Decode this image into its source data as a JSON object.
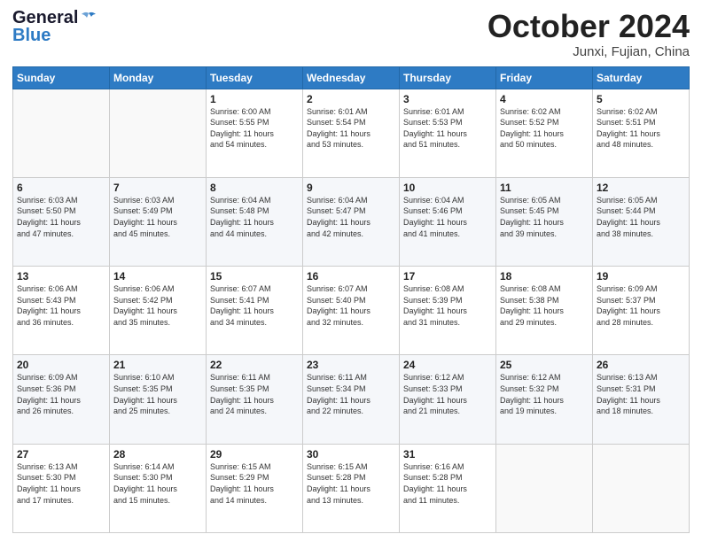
{
  "header": {
    "logo_general": "General",
    "logo_blue": "Blue",
    "month_title": "October 2024",
    "location": "Junxi, Fujian, China"
  },
  "calendar": {
    "days_of_week": [
      "Sunday",
      "Monday",
      "Tuesday",
      "Wednesday",
      "Thursday",
      "Friday",
      "Saturday"
    ],
    "weeks": [
      [
        {
          "day": "",
          "content": ""
        },
        {
          "day": "",
          "content": ""
        },
        {
          "day": "1",
          "content": "Sunrise: 6:00 AM\nSunset: 5:55 PM\nDaylight: 11 hours\nand 54 minutes."
        },
        {
          "day": "2",
          "content": "Sunrise: 6:01 AM\nSunset: 5:54 PM\nDaylight: 11 hours\nand 53 minutes."
        },
        {
          "day": "3",
          "content": "Sunrise: 6:01 AM\nSunset: 5:53 PM\nDaylight: 11 hours\nand 51 minutes."
        },
        {
          "day": "4",
          "content": "Sunrise: 6:02 AM\nSunset: 5:52 PM\nDaylight: 11 hours\nand 50 minutes."
        },
        {
          "day": "5",
          "content": "Sunrise: 6:02 AM\nSunset: 5:51 PM\nDaylight: 11 hours\nand 48 minutes."
        }
      ],
      [
        {
          "day": "6",
          "content": "Sunrise: 6:03 AM\nSunset: 5:50 PM\nDaylight: 11 hours\nand 47 minutes."
        },
        {
          "day": "7",
          "content": "Sunrise: 6:03 AM\nSunset: 5:49 PM\nDaylight: 11 hours\nand 45 minutes."
        },
        {
          "day": "8",
          "content": "Sunrise: 6:04 AM\nSunset: 5:48 PM\nDaylight: 11 hours\nand 44 minutes."
        },
        {
          "day": "9",
          "content": "Sunrise: 6:04 AM\nSunset: 5:47 PM\nDaylight: 11 hours\nand 42 minutes."
        },
        {
          "day": "10",
          "content": "Sunrise: 6:04 AM\nSunset: 5:46 PM\nDaylight: 11 hours\nand 41 minutes."
        },
        {
          "day": "11",
          "content": "Sunrise: 6:05 AM\nSunset: 5:45 PM\nDaylight: 11 hours\nand 39 minutes."
        },
        {
          "day": "12",
          "content": "Sunrise: 6:05 AM\nSunset: 5:44 PM\nDaylight: 11 hours\nand 38 minutes."
        }
      ],
      [
        {
          "day": "13",
          "content": "Sunrise: 6:06 AM\nSunset: 5:43 PM\nDaylight: 11 hours\nand 36 minutes."
        },
        {
          "day": "14",
          "content": "Sunrise: 6:06 AM\nSunset: 5:42 PM\nDaylight: 11 hours\nand 35 minutes."
        },
        {
          "day": "15",
          "content": "Sunrise: 6:07 AM\nSunset: 5:41 PM\nDaylight: 11 hours\nand 34 minutes."
        },
        {
          "day": "16",
          "content": "Sunrise: 6:07 AM\nSunset: 5:40 PM\nDaylight: 11 hours\nand 32 minutes."
        },
        {
          "day": "17",
          "content": "Sunrise: 6:08 AM\nSunset: 5:39 PM\nDaylight: 11 hours\nand 31 minutes."
        },
        {
          "day": "18",
          "content": "Sunrise: 6:08 AM\nSunset: 5:38 PM\nDaylight: 11 hours\nand 29 minutes."
        },
        {
          "day": "19",
          "content": "Sunrise: 6:09 AM\nSunset: 5:37 PM\nDaylight: 11 hours\nand 28 minutes."
        }
      ],
      [
        {
          "day": "20",
          "content": "Sunrise: 6:09 AM\nSunset: 5:36 PM\nDaylight: 11 hours\nand 26 minutes."
        },
        {
          "day": "21",
          "content": "Sunrise: 6:10 AM\nSunset: 5:35 PM\nDaylight: 11 hours\nand 25 minutes."
        },
        {
          "day": "22",
          "content": "Sunrise: 6:11 AM\nSunset: 5:35 PM\nDaylight: 11 hours\nand 24 minutes."
        },
        {
          "day": "23",
          "content": "Sunrise: 6:11 AM\nSunset: 5:34 PM\nDaylight: 11 hours\nand 22 minutes."
        },
        {
          "day": "24",
          "content": "Sunrise: 6:12 AM\nSunset: 5:33 PM\nDaylight: 11 hours\nand 21 minutes."
        },
        {
          "day": "25",
          "content": "Sunrise: 6:12 AM\nSunset: 5:32 PM\nDaylight: 11 hours\nand 19 minutes."
        },
        {
          "day": "26",
          "content": "Sunrise: 6:13 AM\nSunset: 5:31 PM\nDaylight: 11 hours\nand 18 minutes."
        }
      ],
      [
        {
          "day": "27",
          "content": "Sunrise: 6:13 AM\nSunset: 5:30 PM\nDaylight: 11 hours\nand 17 minutes."
        },
        {
          "day": "28",
          "content": "Sunrise: 6:14 AM\nSunset: 5:30 PM\nDaylight: 11 hours\nand 15 minutes."
        },
        {
          "day": "29",
          "content": "Sunrise: 6:15 AM\nSunset: 5:29 PM\nDaylight: 11 hours\nand 14 minutes."
        },
        {
          "day": "30",
          "content": "Sunrise: 6:15 AM\nSunset: 5:28 PM\nDaylight: 11 hours\nand 13 minutes."
        },
        {
          "day": "31",
          "content": "Sunrise: 6:16 AM\nSunset: 5:28 PM\nDaylight: 11 hours\nand 11 minutes."
        },
        {
          "day": "",
          "content": ""
        },
        {
          "day": "",
          "content": ""
        }
      ]
    ]
  }
}
